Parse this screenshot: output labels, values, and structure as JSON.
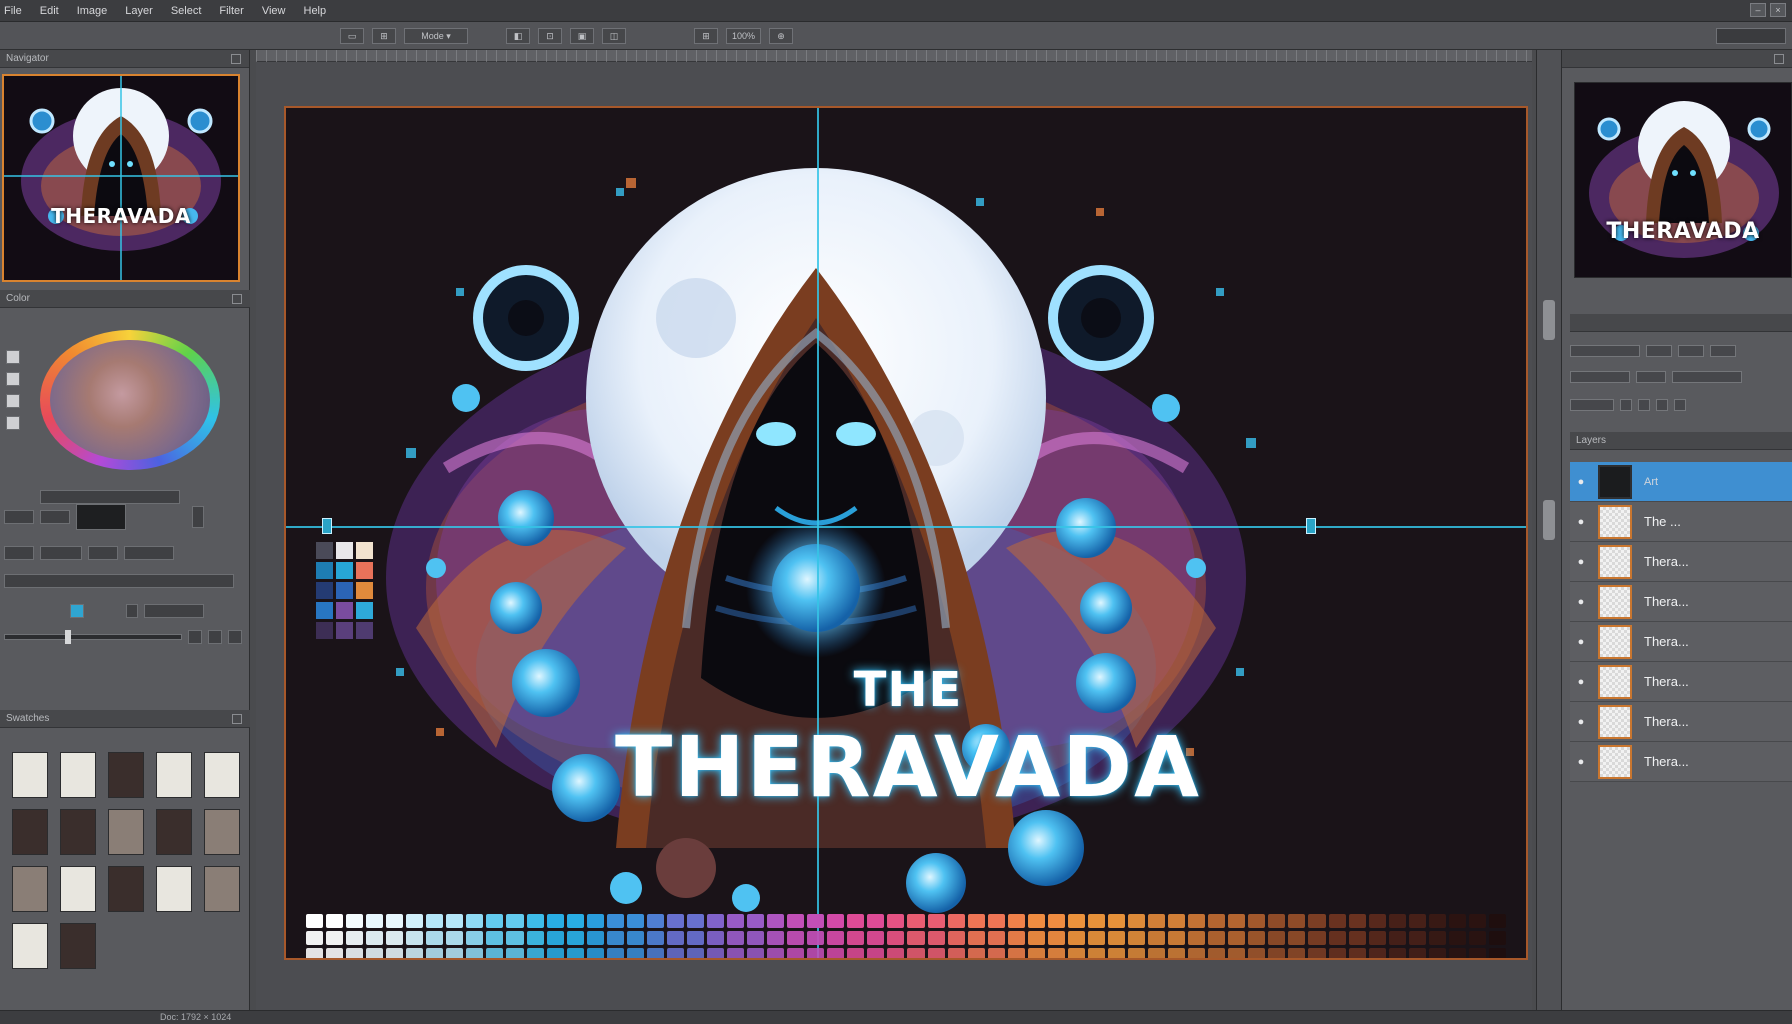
{
  "menu": {
    "items": [
      "File",
      "Edit",
      "Image",
      "Layer",
      "Select",
      "Filter",
      "View",
      "Help"
    ]
  },
  "toolbar": {
    "buttons": [
      "▭",
      "⊞",
      "Mode ▾",
      "◧",
      "⊡",
      "▣",
      "◫",
      "⊞",
      "100%",
      "⊕"
    ]
  },
  "left_panel": {
    "navigator_header": "Navigator",
    "preview_title": "THERAVADA",
    "color_header": "Color",
    "swatches_header": "Swatches"
  },
  "canvas": {
    "title_small": "THE",
    "title_big": "THERAVADA",
    "mini_palette": [
      "#4a4a58",
      "#e9e7ea",
      "#f2e2cf",
      "#1e7db3",
      "#27a6d6",
      "#e8725a",
      "#243b73",
      "#2b64b6",
      "#e08a3c",
      "#2876c2",
      "#7a4c9f",
      "#2ea9d9",
      "#3d2e55",
      "#5a3f7c",
      "#4f3b70"
    ],
    "palette_colors": [
      "#ffffff",
      "#f4fbfe",
      "#e8f7fd",
      "#d2f0fb",
      "#b5e6f8",
      "#8fdaf4",
      "#63cbef",
      "#3ebce9",
      "#29ade4",
      "#2a9ddd",
      "#3a8ed8",
      "#4f7ed3",
      "#6870cf",
      "#8163cb",
      "#985bc6",
      "#ae55c0",
      "#c24fb7",
      "#d34aa8",
      "#de4b96",
      "#e55283",
      "#e95d72",
      "#ec6962",
      "#ee7555",
      "#ef814a",
      "#ef8c41",
      "#ec923c",
      "#e6913a",
      "#dd8a39",
      "#d27f37",
      "#c47234",
      "#b46530",
      "#a2582c",
      "#8f4b28",
      "#7c3e24",
      "#6a3220",
      "#58281c",
      "#472018",
      "#381914",
      "#2b1311",
      "#1f0e0e"
    ]
  },
  "right_panel": {
    "preview_title": "THERAVADA",
    "layers_header": "Layers",
    "layers": [
      {
        "name": "Art",
        "selected": true
      },
      {
        "name": "The ...",
        "selected": false
      },
      {
        "name": "Thera...",
        "selected": false
      },
      {
        "name": "Thera...",
        "selected": false
      },
      {
        "name": "Thera...",
        "selected": false
      },
      {
        "name": "Thera...",
        "selected": false
      },
      {
        "name": "Thera...",
        "selected": false
      },
      {
        "name": "Thera...",
        "selected": false
      }
    ]
  },
  "status": {
    "text": "Doc: 1792 × 1024"
  }
}
